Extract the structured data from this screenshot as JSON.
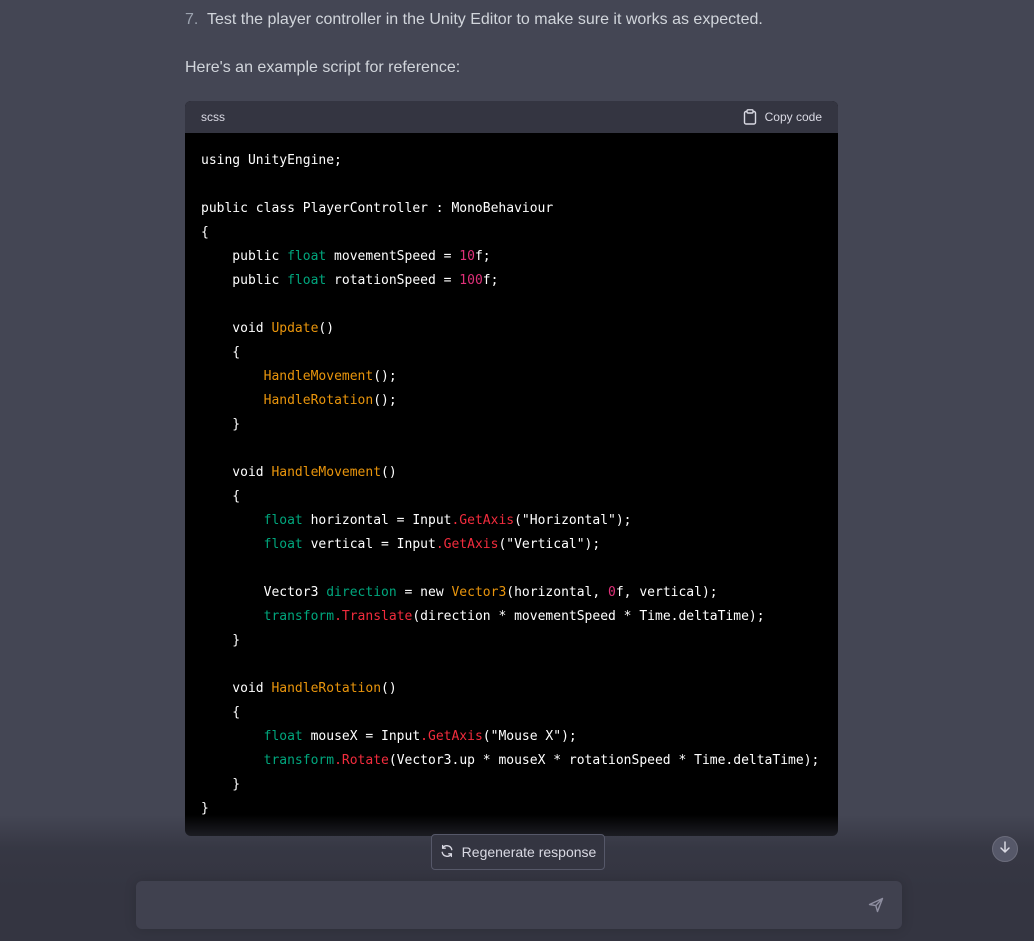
{
  "message": {
    "step_number": "7.",
    "step_text": "Test the player controller in the Unity Editor to make sure it works as expected.",
    "intro_text": "Here's an example script for reference:"
  },
  "code_block": {
    "language": "scss",
    "copy_label": "Copy code",
    "lines": [
      [
        {
          "t": "using UnityEngine;",
          "c": "kw"
        }
      ],
      [],
      [
        {
          "t": "public class PlayerController : MonoBehaviour",
          "c": "kw"
        }
      ],
      [
        {
          "t": "{",
          "c": "kw"
        }
      ],
      [
        {
          "t": "    public ",
          "c": "kw"
        },
        {
          "t": "float",
          "c": "tg"
        },
        {
          "t": " movementSpeed = ",
          "c": "kw"
        },
        {
          "t": "10",
          "c": "nm"
        },
        {
          "t": "f;",
          "c": "kw"
        }
      ],
      [
        {
          "t": "    public ",
          "c": "kw"
        },
        {
          "t": "float",
          "c": "tg"
        },
        {
          "t": " rotationSpeed = ",
          "c": "kw"
        },
        {
          "t": "100",
          "c": "nm"
        },
        {
          "t": "f;",
          "c": "kw"
        }
      ],
      [],
      [
        {
          "t": "    void ",
          "c": "kw"
        },
        {
          "t": "Update",
          "c": "fo"
        },
        {
          "t": "()",
          "c": "kw"
        }
      ],
      [
        {
          "t": "    {",
          "c": "kw"
        }
      ],
      [
        {
          "t": "        ",
          "c": "kw"
        },
        {
          "t": "HandleMovement",
          "c": "fo"
        },
        {
          "t": "();",
          "c": "kw"
        }
      ],
      [
        {
          "t": "        ",
          "c": "kw"
        },
        {
          "t": "HandleRotation",
          "c": "fo"
        },
        {
          "t": "();",
          "c": "kw"
        }
      ],
      [
        {
          "t": "    }",
          "c": "kw"
        }
      ],
      [],
      [
        {
          "t": "    void ",
          "c": "kw"
        },
        {
          "t": "HandleMovement",
          "c": "fo"
        },
        {
          "t": "()",
          "c": "kw"
        }
      ],
      [
        {
          "t": "    {",
          "c": "kw"
        }
      ],
      [
        {
          "t": "        ",
          "c": "kw"
        },
        {
          "t": "float",
          "c": "tg"
        },
        {
          "t": " horizontal = Input",
          "c": "kw"
        },
        {
          "t": ".GetAxis",
          "c": "fn"
        },
        {
          "t": "(\"Horizontal\");",
          "c": "kw"
        }
      ],
      [
        {
          "t": "        ",
          "c": "kw"
        },
        {
          "t": "float",
          "c": "tg"
        },
        {
          "t": " vertical = Input",
          "c": "kw"
        },
        {
          "t": ".GetAxis",
          "c": "fn"
        },
        {
          "t": "(\"Vertical\");",
          "c": "kw"
        }
      ],
      [],
      [
        {
          "t": "        Vector3 ",
          "c": "kw"
        },
        {
          "t": "direction",
          "c": "tg"
        },
        {
          "t": " = new ",
          "c": "kw"
        },
        {
          "t": "Vector3",
          "c": "fo"
        },
        {
          "t": "(horizontal, ",
          "c": "kw"
        },
        {
          "t": "0",
          "c": "nm"
        },
        {
          "t": "f, vertical);",
          "c": "kw"
        }
      ],
      [
        {
          "t": "        ",
          "c": "kw"
        },
        {
          "t": "transform",
          "c": "tg"
        },
        {
          "t": ".Translate",
          "c": "fn"
        },
        {
          "t": "(direction * movementSpeed * Time.deltaTime);",
          "c": "kw"
        }
      ],
      [
        {
          "t": "    }",
          "c": "kw"
        }
      ],
      [],
      [
        {
          "t": "    void ",
          "c": "kw"
        },
        {
          "t": "HandleRotation",
          "c": "fo"
        },
        {
          "t": "()",
          "c": "kw"
        }
      ],
      [
        {
          "t": "    {",
          "c": "kw"
        }
      ],
      [
        {
          "t": "        ",
          "c": "kw"
        },
        {
          "t": "float",
          "c": "tg"
        },
        {
          "t": " mouseX = Input",
          "c": "kw"
        },
        {
          "t": ".GetAxis",
          "c": "fn"
        },
        {
          "t": "(\"Mouse X\");",
          "c": "kw"
        }
      ],
      [
        {
          "t": "        ",
          "c": "kw"
        },
        {
          "t": "transform",
          "c": "tg"
        },
        {
          "t": ".Rotate",
          "c": "fn"
        },
        {
          "t": "(Vector3.up * mouseX * rotationSpeed * Time.deltaTime);",
          "c": "kw"
        }
      ],
      [
        {
          "t": "    }",
          "c": "kw"
        }
      ],
      [
        {
          "t": "}",
          "c": "kw"
        }
      ]
    ]
  },
  "regenerate": {
    "label": "Regenerate response"
  },
  "composer": {
    "value": ""
  },
  "colors": {
    "page_bg": "#444654",
    "bar_bg": "#343541",
    "code_bg": "#000000",
    "input_bg": "#40414f"
  },
  "icons": {
    "copy": "clipboard-icon",
    "regenerate": "refresh-icon",
    "send": "send-icon",
    "scroll": "arrow-down-icon"
  }
}
